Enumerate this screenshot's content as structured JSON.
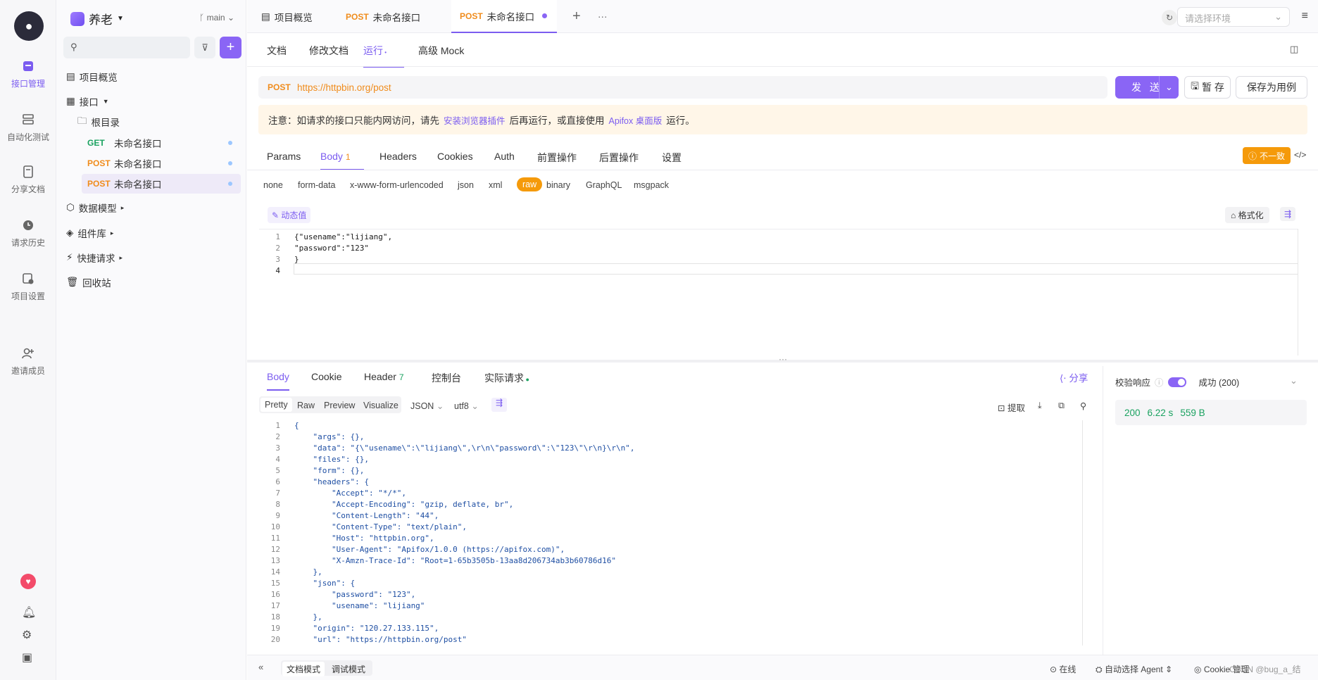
{
  "rail": {
    "items": [
      {
        "label": "接口管理"
      },
      {
        "label": "自动化测试"
      },
      {
        "label": "分享文档"
      },
      {
        "label": "请求历史"
      },
      {
        "label": "项目设置"
      },
      {
        "label": "邀请成员"
      }
    ]
  },
  "sidebar": {
    "project": "养老",
    "branch": "main",
    "tree": {
      "overview": "项目概览",
      "apis": "接口",
      "root": "根目录",
      "items": [
        {
          "method": "GET",
          "name": "未命名接口"
        },
        {
          "method": "POST",
          "name": "未命名接口"
        },
        {
          "method": "POST",
          "name": "未命名接口"
        }
      ],
      "models": "数据模型",
      "components": "组件库",
      "quick": "快捷请求",
      "trash": "回收站"
    }
  },
  "tabs": {
    "overview": "项目概览",
    "t1_method": "POST",
    "t1_name": "未命名接口",
    "t2_method": "POST",
    "t2_name": "未命名接口",
    "env_placeholder": "请选择环境"
  },
  "subtabs": {
    "doc": "文档",
    "edit": "修改文档",
    "run": "运行",
    "mock": "高级 Mock"
  },
  "request": {
    "method": "POST",
    "url": "https://httpbin.org/post",
    "send": "发 送",
    "save_tmp": "暂 存",
    "save_case": "保存为用例"
  },
  "notice": {
    "p1": "注意：如请求的接口只能内网访问，请先",
    "link1": "安装浏览器插件",
    "p2": "后再运行，或直接使用",
    "link2": "Apifox 桌面版",
    "p3": "运行。"
  },
  "params_tabs": {
    "params": "Params",
    "body": "Body",
    "body_count": "1",
    "headers": "Headers",
    "cookies": "Cookies",
    "auth": "Auth",
    "pre": "前置操作",
    "post": "后置操作",
    "settings": "设置",
    "mismatch": "不一致"
  },
  "body_types": [
    "none",
    "form-data",
    "x-www-form-urlencoded",
    "json",
    "xml",
    "raw",
    "binary",
    "GraphQL",
    "msgpack"
  ],
  "editor": {
    "dynamic": "动态值",
    "format": "格式化",
    "lines": [
      "{\"usename\":\"lijiang\",",
      "\"password\":\"123\"",
      "}",
      ""
    ]
  },
  "response_tabs": {
    "body": "Body",
    "cookie": "Cookie",
    "header": "Header",
    "header_count": "7",
    "console": "控制台",
    "actual": "实际请求",
    "share": "分享"
  },
  "resp_formats": {
    "pretty": "Pretty",
    "raw": "Raw",
    "preview": "Preview",
    "visualize": "Visualize",
    "json": "JSON",
    "charset": "utf8",
    "extract": "提取"
  },
  "response_lines": [
    "{",
    "    \"args\": {},",
    "    \"data\": \"{\\\"usename\\\":\\\"lijiang\\\",\\r\\n\\\"password\\\":\\\"123\\\"\\r\\n}\\r\\n\",",
    "    \"files\": {},",
    "    \"form\": {},",
    "    \"headers\": {",
    "        \"Accept\": \"*/*\",",
    "        \"Accept-Encoding\": \"gzip, deflate, br\",",
    "        \"Content-Length\": \"44\",",
    "        \"Content-Type\": \"text/plain\",",
    "        \"Host\": \"httpbin.org\",",
    "        \"User-Agent\": \"Apifox/1.0.0 (https://apifox.com)\",",
    "        \"X-Amzn-Trace-Id\": \"Root=1-65b3505b-13aa8d206734ab3b60786d16\"",
    "    },",
    "    \"json\": {",
    "        \"password\": \"123\",",
    "        \"usename\": \"lijiang\"",
    "    },",
    "    \"origin\": \"120.27.133.115\",",
    "    \"url\": \"https://httpbin.org/post\""
  ],
  "validation": {
    "label": "校验响应",
    "result": "成功 (200)",
    "status": "200",
    "time": "6.22 s",
    "size": "559 B"
  },
  "statusbar": {
    "doc_mode": "文档模式",
    "debug_mode": "调试模式",
    "online": "在线",
    "agent": "自动选择 Agent",
    "cookie": "Cookie 管理",
    "watermark": "CSDN @bug_a_结"
  }
}
